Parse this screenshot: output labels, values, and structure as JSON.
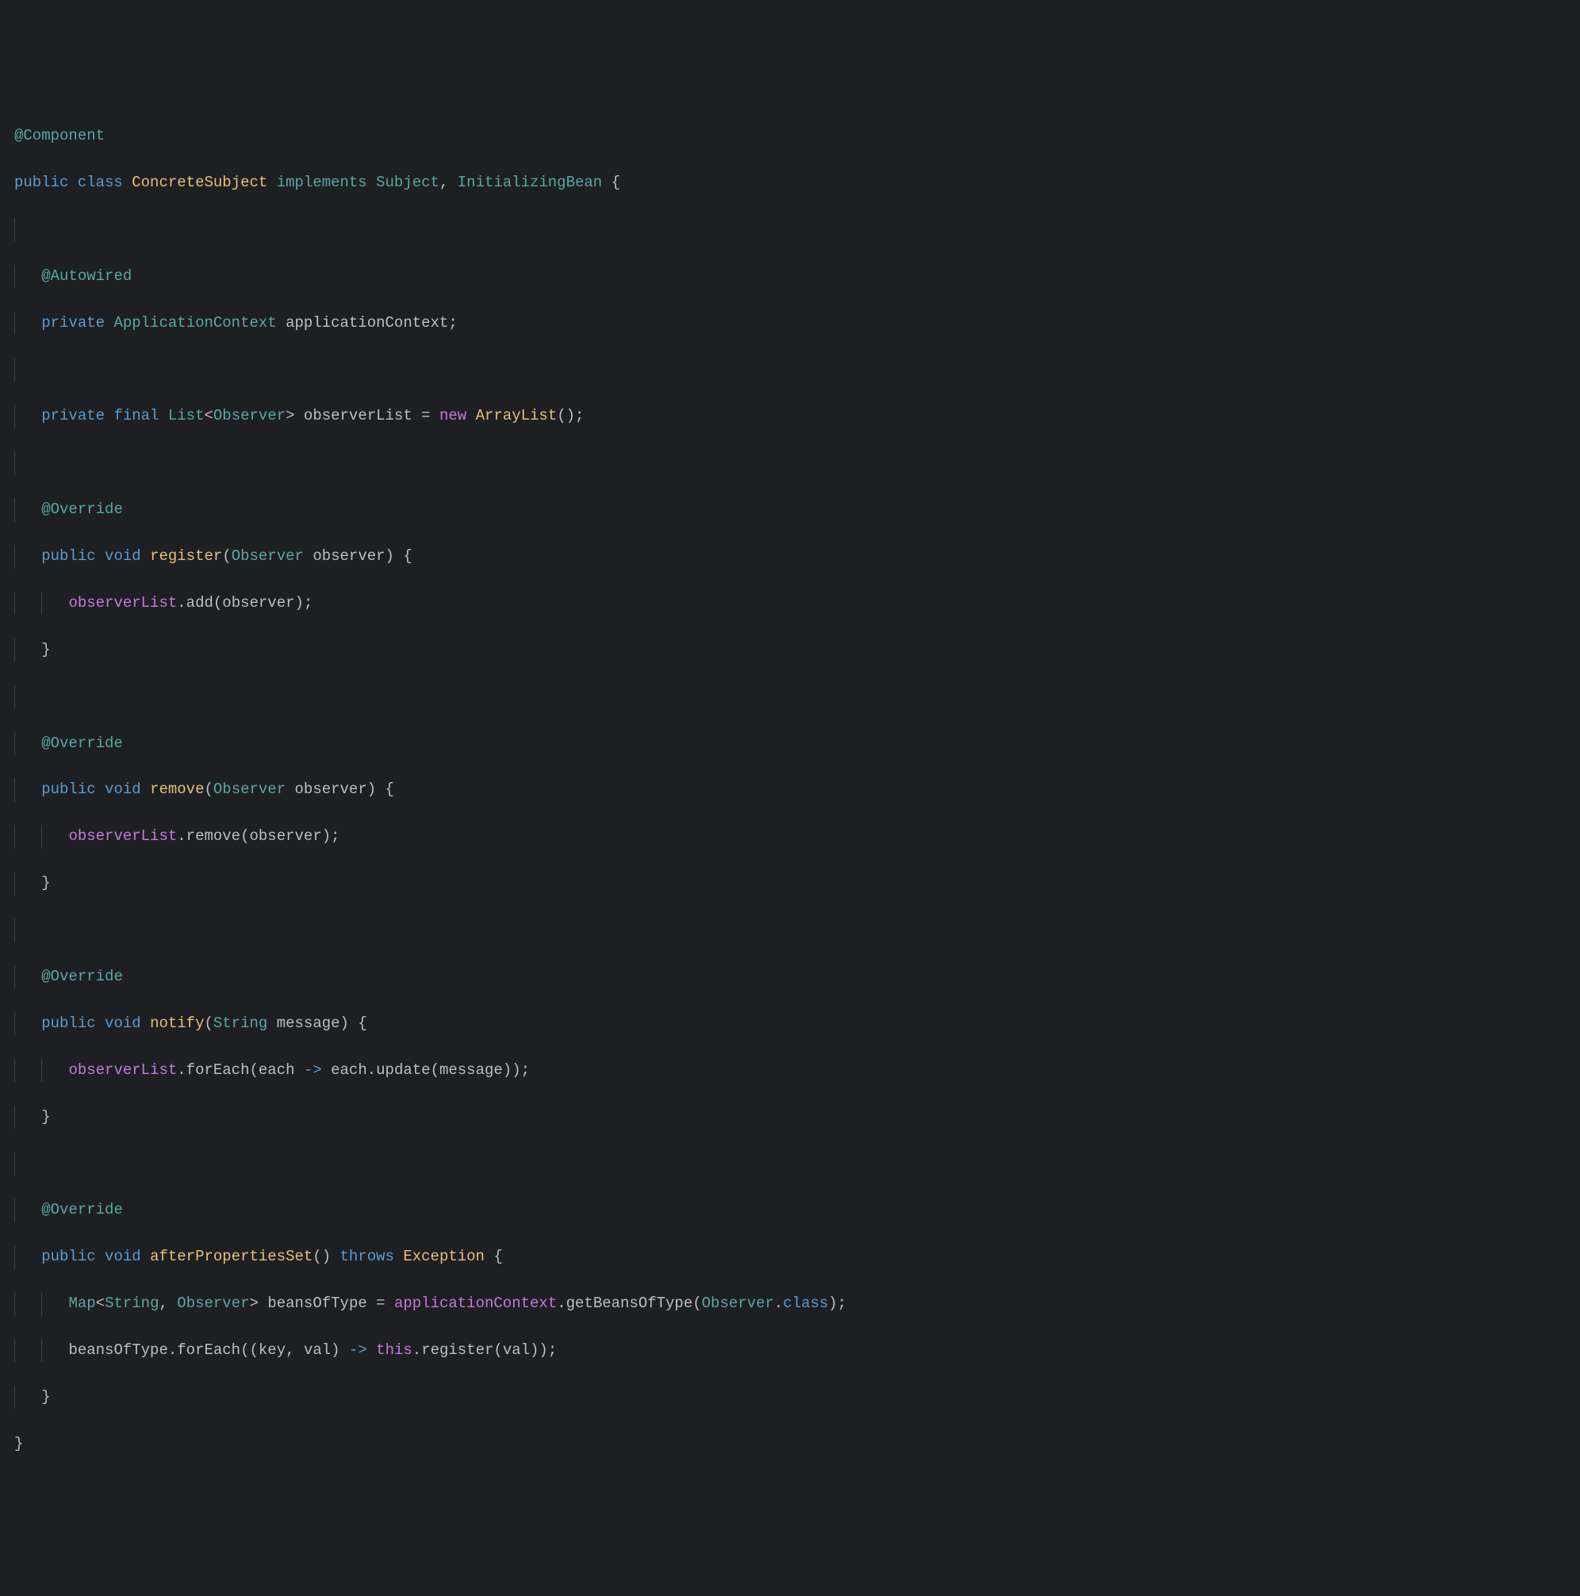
{
  "code": {
    "line1": {
      "at": "@",
      "component": "Component"
    },
    "line2": {
      "public": "public",
      "class": "class",
      "name": "ConcreteSubject",
      "implements": "implements",
      "iface1": "Subject",
      "comma": ",",
      "iface2": "InitializingBean",
      "brace": " {"
    },
    "line4": {
      "at": "@",
      "autowired": "Autowired"
    },
    "line5": {
      "private": "private",
      "type": "ApplicationContext",
      "name": "applicationContext",
      "semi": ";"
    },
    "line7": {
      "private": "private",
      "final": "final",
      "list": "List",
      "lt": "<",
      "observer": "Observer",
      "gt": ">",
      "name": "observerList",
      "eq": " = ",
      "new": "new",
      "arraylist": "ArrayList",
      "parens": "();"
    },
    "line9": {
      "at": "@",
      "override": "Override"
    },
    "line10": {
      "public": "public",
      "void": "void",
      "method": "register",
      "lparen": "(",
      "ptype": "Observer",
      "pname": "observer",
      "rparen": ") {"
    },
    "line11": {
      "obj": "observerList",
      "dot": ".",
      "call": "add",
      "lparen": "(",
      "arg": "observer",
      "rparen": ");"
    },
    "line12": {
      "brace": "}"
    },
    "line14": {
      "at": "@",
      "override": "Override"
    },
    "line15": {
      "public": "public",
      "void": "void",
      "method": "remove",
      "lparen": "(",
      "ptype": "Observer",
      "pname": "observer",
      "rparen": ") {"
    },
    "line16": {
      "obj": "observerList",
      "dot": ".",
      "call": "remove",
      "lparen": "(",
      "arg": "observer",
      "rparen": ");"
    },
    "line17": {
      "brace": "}"
    },
    "line19": {
      "at": "@",
      "override": "Override"
    },
    "line20": {
      "public": "public",
      "void": "void",
      "method": "notify",
      "lparen": "(",
      "ptype": "String",
      "pname": "message",
      "rparen": ") {"
    },
    "line21": {
      "obj": "observerList",
      "dot": ".",
      "call": "forEach",
      "lparen": "(",
      "each": "each",
      "arrow": " -> ",
      "each2": "each",
      "dot2": ".",
      "update": "update",
      "lparen2": "(",
      "msg": "message",
      "rparen": "));"
    },
    "line22": {
      "brace": "}"
    },
    "line24": {
      "at": "@",
      "override": "Override"
    },
    "line25": {
      "public": "public",
      "void": "void",
      "method": "afterPropertiesSet",
      "parens": "()",
      "throws": "throws",
      "exc": "Exception",
      "brace": " {"
    },
    "line26": {
      "map": "Map",
      "lt": "<",
      "string": "String",
      "comma": ", ",
      "observer": "Observer",
      "gt": ">",
      "name": "beansOfType",
      "eq": " = ",
      "ctx": "applicationContext",
      "dot": ".",
      "call": "getBeansOfType",
      "lparen": "(",
      "obs": "Observer",
      "dotclass": ".",
      "class": "class",
      "rparen": ");"
    },
    "line27": {
      "obj": "beansOfType",
      "dot": ".",
      "call": "forEach",
      "lparen": "((",
      "key": "key",
      "comma": ", ",
      "val": "val",
      "rparen1": ")",
      "arrow": " -> ",
      "this": "this",
      "dot2": ".",
      "reg": "register",
      "lparen2": "(",
      "val2": "val",
      "rparen": "));"
    },
    "line28": {
      "brace": "}"
    },
    "line29": {
      "brace": "}"
    }
  }
}
